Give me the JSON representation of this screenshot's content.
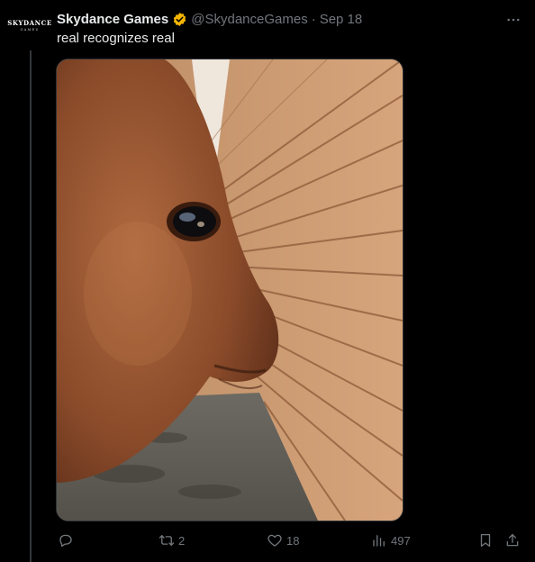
{
  "tweet": {
    "avatar": {
      "brand": "SKYDANCE",
      "brand_sub": "GAMES"
    },
    "author": {
      "display_name": "Skydance Games",
      "verified": true,
      "verified_color": "#f4b400",
      "handle": "@SkydanceGames",
      "separator": "·",
      "date": "Sep 18"
    },
    "text": "real recognizes real",
    "media": {
      "description_icon": "photo"
    },
    "actions": {
      "reply": {
        "icon": "reply-icon",
        "count": ""
      },
      "retweet": {
        "icon": "retweet-icon",
        "count": "2"
      },
      "like": {
        "icon": "heart-icon",
        "count": "18"
      },
      "views": {
        "icon": "views-icon",
        "count": "497"
      },
      "bookmark": {
        "icon": "bookmark-icon"
      },
      "share": {
        "icon": "share-icon"
      }
    },
    "more_icon": "more-icon"
  },
  "colors": {
    "background": "#000000",
    "text_primary": "#e7e9ea",
    "text_secondary": "#71767b",
    "border": "#2f3336"
  }
}
